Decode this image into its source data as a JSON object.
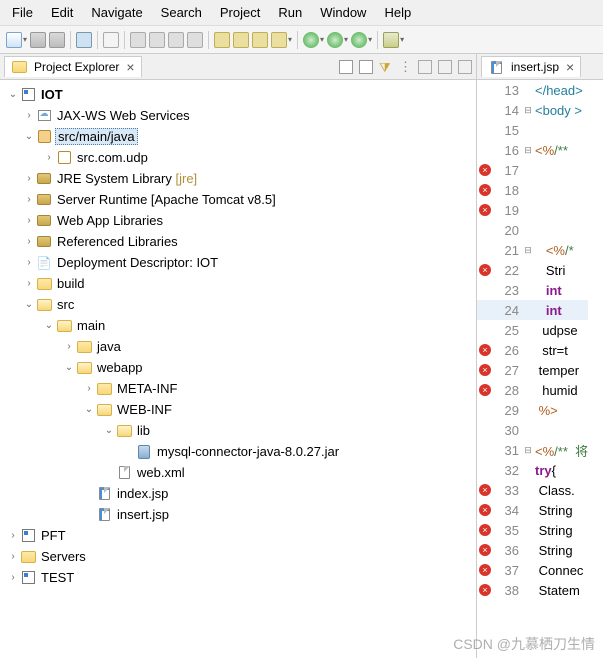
{
  "menu": [
    "File",
    "Edit",
    "Navigate",
    "Search",
    "Project",
    "Run",
    "Window",
    "Help"
  ],
  "explorer": {
    "title": "Project Explorer",
    "projects": {
      "iot": "IOT",
      "pft": "PFT",
      "servers": "Servers",
      "test": "TEST"
    },
    "nodes": {
      "jaxws": "JAX-WS Web Services",
      "srcmainjava": "src/main/java",
      "srccomudp": "src.com.udp",
      "jre": "JRE System Library",
      "jre_dec": "[jre]",
      "tomcat": "Server Runtime [Apache Tomcat v8.5]",
      "webapplib": "Web App Libraries",
      "reflib": "Referenced Libraries",
      "deploy": "Deployment Descriptor: IOT",
      "build": "build",
      "src": "src",
      "main": "main",
      "java": "java",
      "webapp": "webapp",
      "metainf": "META-INF",
      "webinf": "WEB-INF",
      "lib": "lib",
      "mysqljar": "mysql-connector-java-8.0.27.jar",
      "webxml": "web.xml",
      "indexjsp": "index.jsp",
      "insertjsp": "insert.jsp"
    }
  },
  "editor": {
    "tab": "insert.jsp",
    "lines": [
      {
        "n": 13,
        "err": false,
        "fold": "",
        "code": "</head>",
        "cls": "tag"
      },
      {
        "n": 14,
        "err": false,
        "fold": "⊟",
        "code": "<body >",
        "cls": "tag"
      },
      {
        "n": 15,
        "err": false,
        "fold": "",
        "code": "",
        "cls": ""
      },
      {
        "n": 16,
        "err": false,
        "fold": "⊟",
        "code": "<%",
        "cls": "jspd",
        "suffix": "/** ",
        "sfxcls": "cmt"
      },
      {
        "n": 17,
        "err": true,
        "fold": "",
        "code": "",
        "cls": ""
      },
      {
        "n": 18,
        "err": true,
        "fold": "",
        "code": "",
        "cls": ""
      },
      {
        "n": 19,
        "err": true,
        "fold": "",
        "code": "",
        "cls": ""
      },
      {
        "n": 20,
        "err": false,
        "fold": "",
        "code": "",
        "cls": ""
      },
      {
        "n": 21,
        "err": false,
        "fold": "⊟",
        "code": "   <%",
        "cls": "jspd",
        "suffix": "/*",
        "sfxcls": "cmt"
      },
      {
        "n": 22,
        "err": true,
        "fold": "",
        "code": "   Stri",
        "cls": ""
      },
      {
        "n": 23,
        "err": false,
        "fold": "",
        "code": "   int",
        "cls": "kw"
      },
      {
        "n": 24,
        "err": false,
        "fold": "",
        "hl": true,
        "code": "   int",
        "cls": "kw"
      },
      {
        "n": 25,
        "err": false,
        "fold": "",
        "code": "  udpse",
        "cls": ""
      },
      {
        "n": 26,
        "err": true,
        "fold": "",
        "code": "  str=t",
        "cls": ""
      },
      {
        "n": 27,
        "err": true,
        "fold": "",
        "code": " temper",
        "cls": ""
      },
      {
        "n": 28,
        "err": true,
        "fold": "",
        "code": "  humid",
        "cls": ""
      },
      {
        "n": 29,
        "err": false,
        "fold": "",
        "code": " %>",
        "cls": "jspd"
      },
      {
        "n": 30,
        "err": false,
        "fold": "",
        "code": "",
        "cls": ""
      },
      {
        "n": 31,
        "err": false,
        "fold": "⊟",
        "code": "<%",
        "cls": "jspd",
        "suffix": "/**  将",
        "sfxcls": "cmt"
      },
      {
        "n": 32,
        "err": false,
        "fold": "",
        "code": "try",
        "cls": "kw",
        "suffix": "{",
        "sfxcls": ""
      },
      {
        "n": 33,
        "err": true,
        "fold": "",
        "code": " Class.",
        "cls": ""
      },
      {
        "n": 34,
        "err": true,
        "fold": "",
        "code": " String",
        "cls": ""
      },
      {
        "n": 35,
        "err": true,
        "fold": "",
        "code": " String",
        "cls": ""
      },
      {
        "n": 36,
        "err": true,
        "fold": "",
        "code": " String",
        "cls": ""
      },
      {
        "n": 37,
        "err": true,
        "fold": "",
        "code": " Connec",
        "cls": ""
      },
      {
        "n": 38,
        "err": true,
        "fold": "",
        "code": " Statem",
        "cls": ""
      }
    ]
  },
  "watermark": "CSDN @九慕栖刀生情"
}
